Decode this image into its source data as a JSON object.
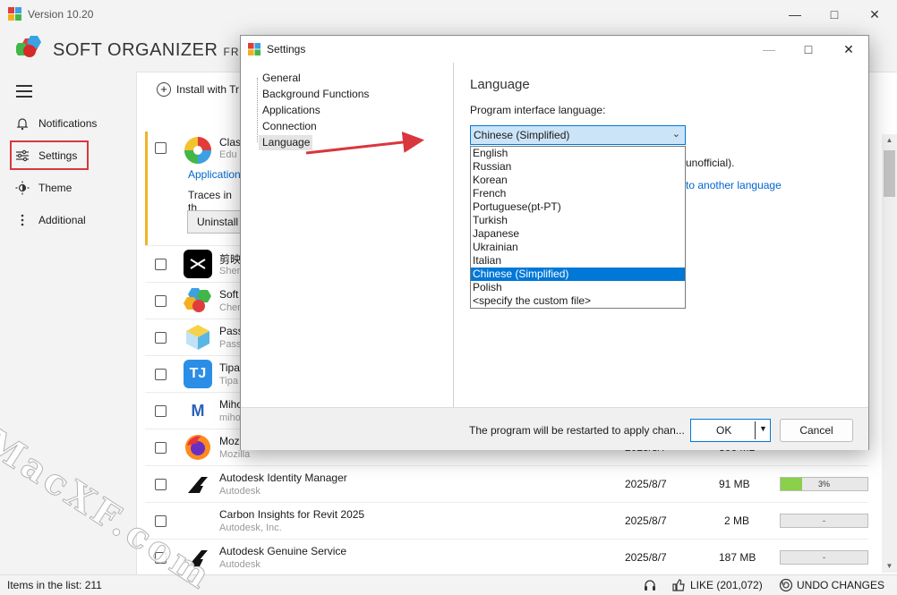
{
  "window": {
    "title": "Version 10.20",
    "minimize_icon": "minimize-icon",
    "maximize_icon": "maximize-icon",
    "close_icon": "close-icon"
  },
  "brand": {
    "name": "SOFT ORGANIZER",
    "edition": "FREE V"
  },
  "sidebar": {
    "menu_icon": "hamburger-icon",
    "items": [
      {
        "label": "Notifications",
        "icon": "bell-icon"
      },
      {
        "label": "Settings",
        "icon": "sliders-icon"
      },
      {
        "label": "Theme",
        "icon": "sun-icon"
      },
      {
        "label": "Additional",
        "icon": "vertical-dots-icon"
      }
    ]
  },
  "toolbar": {
    "install_with": "Install with Tr"
  },
  "expanded_program": {
    "name": "Clas",
    "publisher": "Edu",
    "category_link": "Application",
    "traces_text": "Traces in th",
    "uninstall_label": "Uninstall"
  },
  "programs": [
    {
      "name": "剪映",
      "publisher": "Shen",
      "icon": "capcut-icon"
    },
    {
      "name": "Soft",
      "publisher": "Chem",
      "icon": "soft-organizer-icon"
    },
    {
      "name": "Pass",
      "publisher": "Pass",
      "icon": "passbox-icon"
    },
    {
      "name": "Tipa",
      "publisher": "Tipa",
      "icon": "tipard-icon"
    },
    {
      "name": "Miho",
      "publisher": "miho",
      "icon": "mihomo-icon"
    },
    {
      "name": "Moz",
      "publisher": "Mozilla",
      "icon": "firefox-icon",
      "date": "2025/8/7",
      "size": "306 MB"
    },
    {
      "name": "Autodesk Identity Manager",
      "publisher": "Autodesk",
      "icon": "autodesk-icon",
      "date": "2025/8/7",
      "size": "91 MB",
      "bar": "3%",
      "bar_fraction": 0.03
    },
    {
      "name": "Carbon Insights for Revit 2025",
      "publisher": "Autodesk, Inc.",
      "icon": "",
      "date": "2025/8/7",
      "size": "2 MB",
      "bar": "-"
    },
    {
      "name": "Autodesk Genuine Service",
      "publisher": "Autodesk",
      "icon": "autodesk-icon",
      "date": "2025/8/7",
      "size": "187 MB",
      "bar": "-"
    }
  ],
  "statusbar": {
    "items_count": "Items in the list: 211",
    "like": "LIKE (201,072)",
    "undo": "UNDO CHANGES"
  },
  "watermark": "MacXF.com",
  "dialog": {
    "title": "Settings",
    "tree": [
      "General",
      "Background Functions",
      "Applications",
      "Connection",
      "Language"
    ],
    "selected": "Language",
    "heading": "Language",
    "label": "Program interface language:",
    "selected_language": "Chinese (Simplified)",
    "options": [
      "English",
      "Russian",
      "Korean",
      "French",
      "Portuguese(pt-PT)",
      "Turkish",
      "Japanese",
      "Ukrainian",
      "Italian",
      "Chinese (Simplified)",
      "Polish",
      "<specify the custom file>"
    ],
    "unofficial_note": "unofficial).",
    "translate_link": "to another language",
    "restart_note": "The program will be restarted to apply chan...",
    "ok_label": "OK",
    "cancel_label": "Cancel"
  },
  "colors": {
    "accent": "#0078d7",
    "highlight_box": "#d9363e",
    "annotation_arrow": "#d9363e",
    "expanded_border": "#f0b429",
    "progress_fill": "#8ad04a"
  }
}
